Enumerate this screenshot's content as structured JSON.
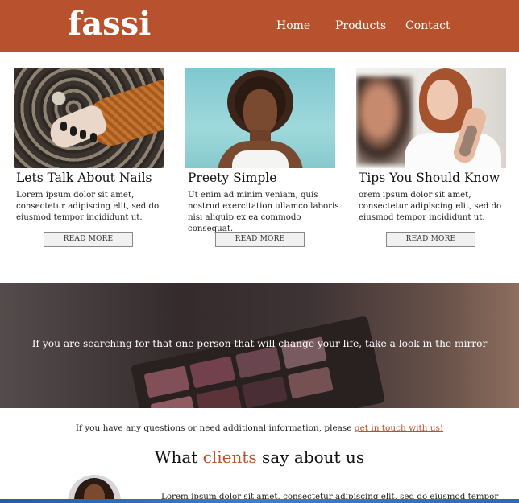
{
  "header": {
    "logo": "fassi",
    "nav": [
      "Home",
      "Products",
      "Contact"
    ]
  },
  "cards": [
    {
      "title": "Lets Talk About Nails",
      "text": "Lorem ipsum dolor sit amet, consectetur adipiscing elit, sed do eiusmod tempor incididunt ut.",
      "button": "READ MORE"
    },
    {
      "title": "Preety Simple",
      "text": "Ut enim ad minim veniam, quis nostrud exercitation ullamco laboris nisi aliquip ex ea commodo consequat.",
      "button": "READ MORE"
    },
    {
      "title": "Tips You Should Know",
      "text": "orem ipsum dolor sit amet, consectetur adipiscing elit, sed do eiusmod tempor incididunt ut.",
      "button": "READ MORE"
    }
  ],
  "banner": {
    "quote": "If you are searching for that one person that will change your life, take a look in the mirror"
  },
  "contact": {
    "text": "If you have any questions or need additional information, please ",
    "link": "get in touch with us!"
  },
  "clients": {
    "title_part1": "What ",
    "title_accent": "clients",
    "title_part2": " say about us",
    "testimonial": "Lorem ipsum dolor sit amet, consectetur adipiscing elit, sed do eiusmod tempor"
  },
  "colors": {
    "brand": "#b8512e"
  }
}
